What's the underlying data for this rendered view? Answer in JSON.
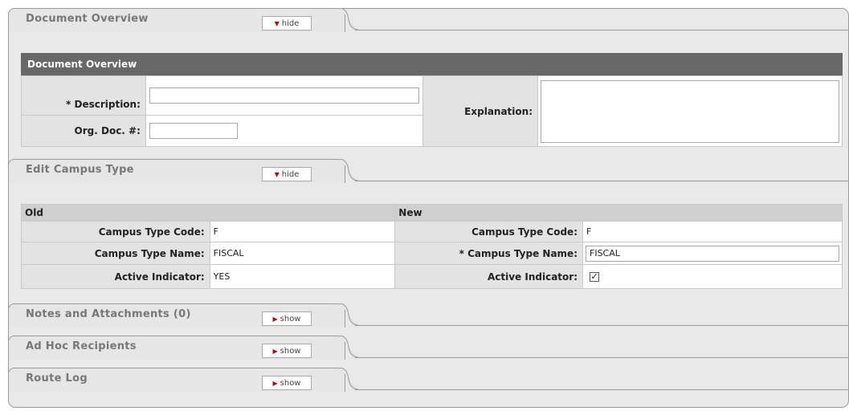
{
  "tabs": {
    "document_overview": {
      "title": "Document Overview",
      "toggle": "hide"
    },
    "edit_campus_type": {
      "title": "Edit Campus Type",
      "toggle": "hide"
    },
    "notes": {
      "title": "Notes and Attachments (0)",
      "toggle": "show"
    },
    "adhoc": {
      "title": "Ad Hoc Recipients",
      "toggle": "show"
    },
    "route_log": {
      "title": "Route Log",
      "toggle": "show"
    }
  },
  "overview": {
    "bar_title": "Document Overview",
    "description_label": "* Description:",
    "description_value": "",
    "org_doc_label": "Org. Doc. #:",
    "org_doc_value": "",
    "explanation_label": "Explanation:",
    "explanation_value": ""
  },
  "campus": {
    "old_header": "Old",
    "new_header": "New",
    "old": {
      "code_label": "Campus Type Code:",
      "code_value": "F",
      "name_label": "Campus Type Name:",
      "name_value": "FISCAL",
      "active_label": "Active Indicator:",
      "active_value": "YES"
    },
    "new": {
      "code_label": "Campus Type Code:",
      "code_value": "F",
      "name_label": "* Campus Type Name:",
      "name_value": "FISCAL",
      "active_label": "Active Indicator:",
      "active_checked": "✓"
    }
  },
  "icons": {
    "hide_arrow": "▼",
    "show_arrow": "▶"
  }
}
